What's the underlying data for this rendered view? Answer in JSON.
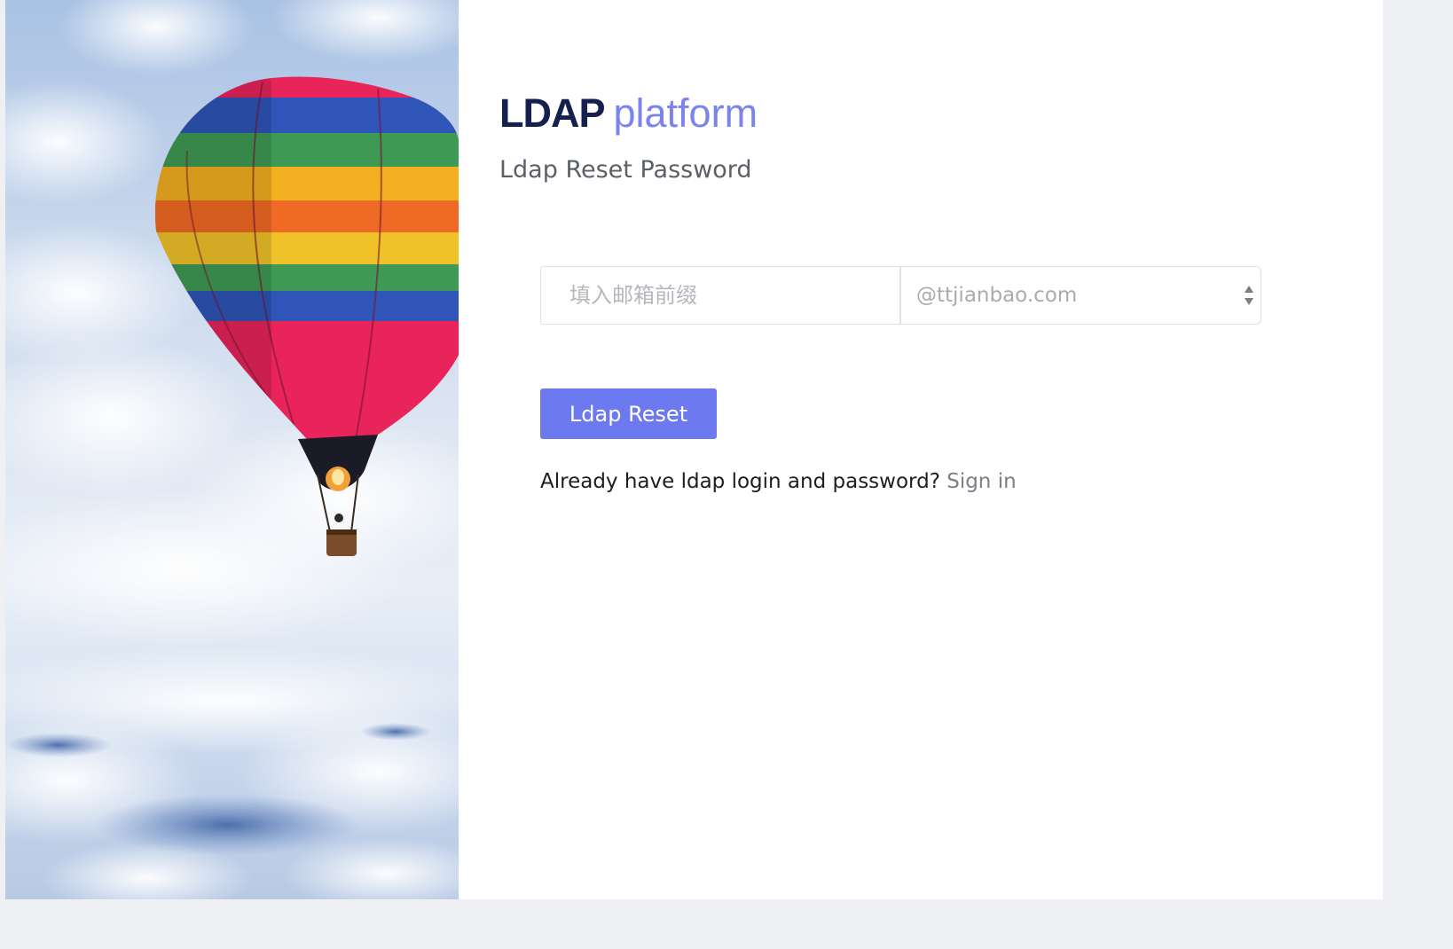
{
  "brand": {
    "strong": "LDAP",
    "light": "platform"
  },
  "page": {
    "subtitle": "Ldap Reset Password"
  },
  "form": {
    "prefix_placeholder": "填入邮箱前缀",
    "prefix_value": "",
    "domain_selected": "@ttjianbao.com",
    "submit_label": "Ldap Reset"
  },
  "signin": {
    "prompt": "Already have ldap login and password?",
    "link_label": "Sign in"
  },
  "icons": {
    "select_arrows": "updown-arrows-icon"
  },
  "colors": {
    "brand_dark": "#14204d",
    "brand_accent": "#7b83ec",
    "button_bg": "#6d79ee"
  }
}
